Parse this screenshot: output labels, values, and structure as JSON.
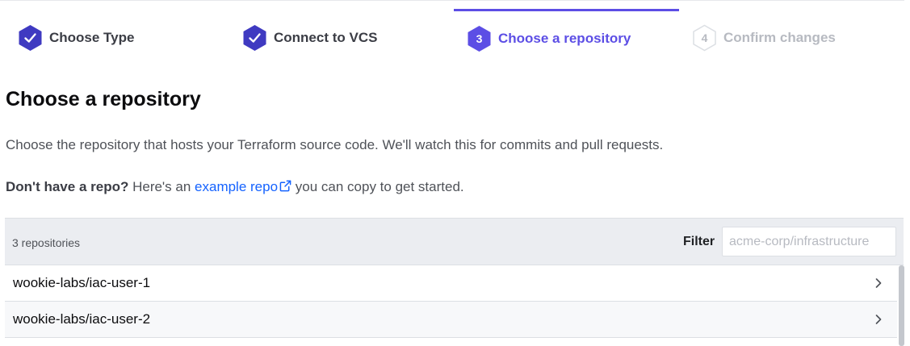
{
  "steps": [
    {
      "number": "1",
      "label": "Choose Type",
      "state": "complete"
    },
    {
      "number": "2",
      "label": "Connect to VCS",
      "state": "complete"
    },
    {
      "number": "3",
      "label": "Choose a repository",
      "state": "active"
    },
    {
      "number": "4",
      "label": "Confirm changes",
      "state": "pending"
    }
  ],
  "colors": {
    "accent": "#5c4ee5",
    "complete_badge": "#3f3ac1",
    "link": "#1563ff",
    "pending": "#b7bac1"
  },
  "page": {
    "title": "Choose a repository",
    "description": "Choose the repository that hosts your Terraform source code. We'll watch this for commits and pull requests.",
    "hint_bold": "Don't have a repo?",
    "hint_before_link": " Here's an ",
    "hint_link": "example repo",
    "hint_after_link": " you can copy to get started."
  },
  "repo_list": {
    "count": "3 repositories",
    "filter_label": "Filter",
    "filter_placeholder": "acme-corp/infrastructure",
    "filter_value": "",
    "rows": [
      {
        "name": "wookie-labs/iac-user-1"
      },
      {
        "name": "wookie-labs/iac-user-2"
      }
    ]
  },
  "icons": {
    "complete": "checkmark-hexagon-icon",
    "external": "external-link-icon",
    "row_action": "chevron-right-icon"
  }
}
